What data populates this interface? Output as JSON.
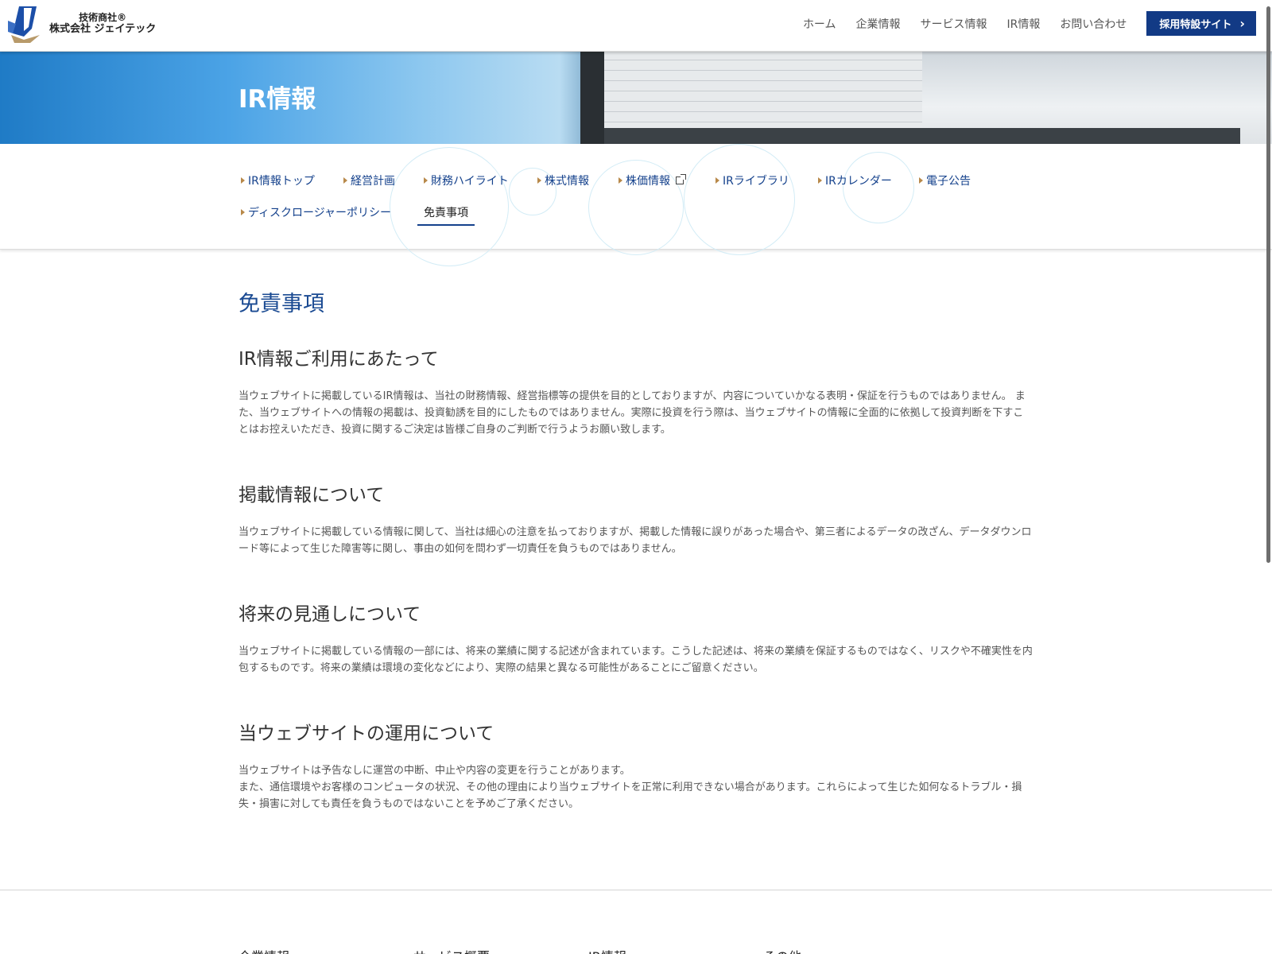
{
  "header": {
    "logo_line1": "技術商社®",
    "logo_line2": "株式会社 ジェイテック",
    "nav": [
      "ホーム",
      "企業情報",
      "サービス情報",
      "IR情報",
      "お問い合わせ"
    ],
    "recruit_label": "採用特設サイト",
    "recruit_chevron": "›"
  },
  "hero": {
    "title": "IR情報"
  },
  "subnav": {
    "items": [
      "IR情報トップ",
      "経営計画",
      "財務ハイライト",
      "株式情報",
      "株価情報",
      "IRライブラリ",
      "IRカレンダー",
      "電子公告",
      "ディスクロージャーポリシー"
    ],
    "active": "免責事項"
  },
  "content": {
    "title": "免責事項",
    "sections": [
      {
        "heading": "IR情報ご利用にあたって",
        "body": "当ウェブサイトに掲載しているIR情報は、当社の財務情報、経営指標等の提供を目的としておりますが、内容についていかなる表明・保証を行うものではありません。 また、当ウェブサイトへの情報の掲載は、投資勧誘を目的にしたものではありません。実際に投資を行う際は、当ウェブサイトの情報に全面的に依拠して投資判断を下すことはお控えいただき、投資に関するご決定は皆様ご自身のご判断で行うようお願い致します。"
      },
      {
        "heading": "掲載情報について",
        "body": "当ウェブサイトに掲載している情報に関して、当社は細心の注意を払っておりますが、掲載した情報に誤りがあった場合や、第三者によるデータの改ざん、データダウンロード等によって生じた障害等に関し、事由の如何を問わず一切責任を負うものではありません。"
      },
      {
        "heading": "将来の見通しについて",
        "body": "当ウェブサイトに掲載している情報の一部には、将来の業績に関する記述が含まれています。こうした記述は、将来の業績を保証するものではなく、リスクや不確実性を内包するものです。将来の業績は環境の変化などにより、実際の結果と異なる可能性があることにご留意ください。"
      },
      {
        "heading": "当ウェブサイトの運用について",
        "body1": "当ウェブサイトは予告なしに運営の中断、中止や内容の変更を行うことがあります。",
        "body2": "また、通信環境やお客様のコンピュータの状況、その他の理由により当ウェブサイトを正常に利用できない場合があります。これらによって生じた如何なるトラブル・損失・損害に対しても責任を負うものではないことを予めご了承ください。"
      }
    ]
  },
  "footer": {
    "nav": [
      "企業情報",
      "サービス概要",
      "IR情報",
      "その他"
    ]
  },
  "colors": {
    "brand_navy": "#123a85",
    "link_blue": "#14418c",
    "arrow_gold": "#b8894a"
  }
}
